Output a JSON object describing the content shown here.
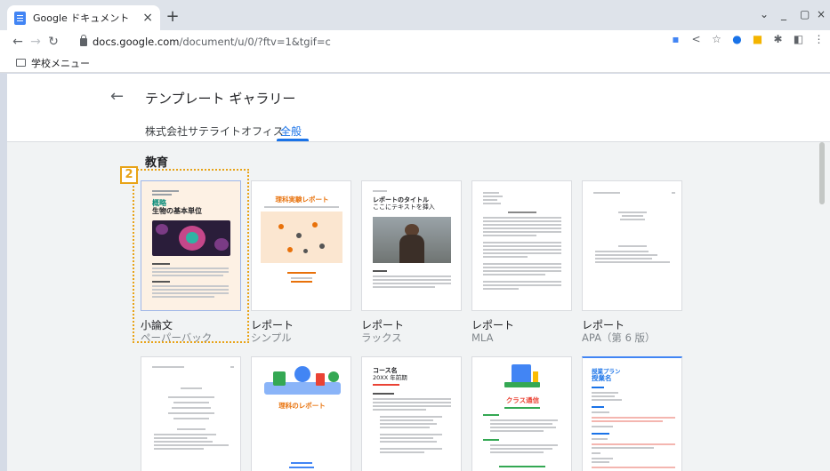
{
  "browser": {
    "tab_title": "Google ドキュメント",
    "tab_close": "×",
    "new_tab": "+",
    "url_host": "docs.google.com",
    "url_path": "/document/u/0/?ftv=1&tgif=c",
    "bookmark_folder": "学校メニュー",
    "window_controls": [
      "⌄",
      "_",
      "▢",
      "×"
    ]
  },
  "header": {
    "back": "←",
    "title": "テンプレート ギャラリー",
    "tabs": [
      {
        "label": "株式会社サテライトオフィス",
        "active": false
      },
      {
        "label": "全般",
        "active": true
      }
    ]
  },
  "section": {
    "title": "教育"
  },
  "step_badge": "2",
  "templates_row1": [
    {
      "name": "小論文",
      "sub": "ペーパーバック",
      "thumb_title_1": "概略",
      "thumb_title_2": "生物の基本単位"
    },
    {
      "name": "レポート",
      "sub": "シンプル",
      "thumb_title_1": "理科実験レポート"
    },
    {
      "name": "レポート",
      "sub": "ラックス",
      "thumb_title_1": "レポートのタイトル",
      "thumb_title_2": "ここにテキストを挿入"
    },
    {
      "name": "レポート",
      "sub": "MLA"
    },
    {
      "name": "レポート",
      "sub": "APA（第 6 版）"
    }
  ],
  "templates_row2": [
    {
      "thumb_title_1": ""
    },
    {
      "thumb_title_1": "理科のレポート"
    },
    {
      "thumb_title_1": "コース名",
      "thumb_title_2": "20XX 年前期"
    },
    {
      "thumb_title_1": "クラス通信"
    },
    {
      "thumb_title_1": "授業プラン",
      "thumb_title_2": "授業名"
    }
  ],
  "colors": {
    "accent": "#1a73e8",
    "highlight": "#e8a317",
    "essay_bg": "#fdf1e4",
    "essay_title": "#0b8c7a"
  }
}
